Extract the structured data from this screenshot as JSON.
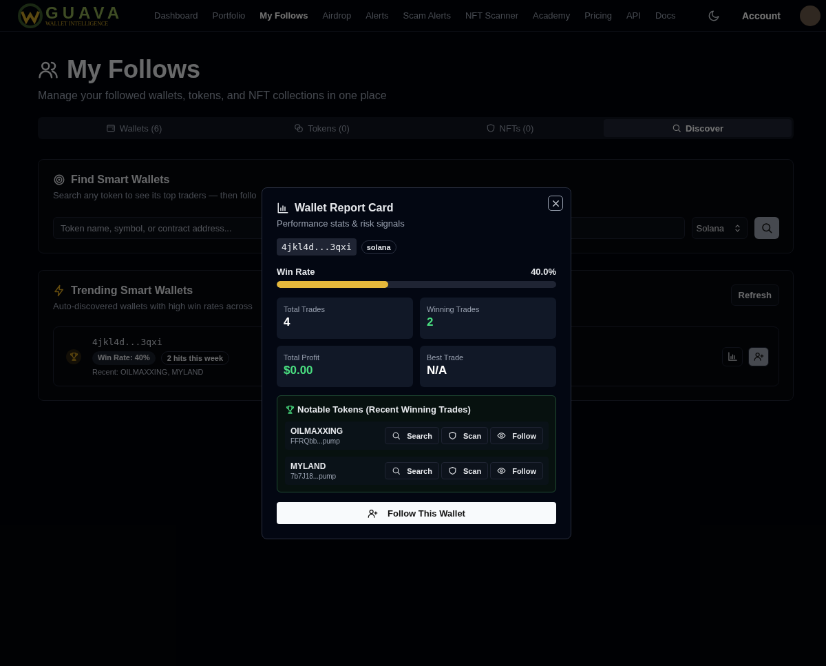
{
  "logo": {
    "name": "GUAVA",
    "tagline": "WALLET INTELLIGENCE"
  },
  "nav": [
    {
      "label": "Dashboard",
      "selected": false
    },
    {
      "label": "Portfolio",
      "selected": false
    },
    {
      "label": "My Follows",
      "selected": true
    },
    {
      "label": "Airdrop",
      "selected": false
    },
    {
      "label": "Alerts",
      "selected": false
    },
    {
      "label": "Scam Alerts",
      "selected": false
    },
    {
      "label": "NFT Scanner",
      "selected": false
    },
    {
      "label": "Academy",
      "selected": false
    },
    {
      "label": "Pricing",
      "selected": false
    },
    {
      "label": "API",
      "selected": false
    },
    {
      "label": "Docs",
      "selected": false
    }
  ],
  "account": "Account",
  "page": {
    "title": "My Follows",
    "subtitle": "Manage your followed wallets, tokens, and NFT collections in one place"
  },
  "tabs": [
    {
      "kind": "wallet",
      "label": "Wallets (6)",
      "selected": false
    },
    {
      "kind": "tokens",
      "label": "Tokens (0)",
      "selected": false
    },
    {
      "kind": "shield",
      "label": "NFTs (0)",
      "selected": false
    },
    {
      "kind": "search",
      "label": "Discover",
      "selected": true
    }
  ],
  "find": {
    "title": "Find Smart Wallets",
    "description": "Search any token to see its top traders — then follo",
    "placeholder": "Token name, symbol, or contract address...",
    "chain": "Solana"
  },
  "trending": {
    "title": "Trending Smart Wallets",
    "description": "Auto-discovered wallets with high win rates across",
    "refresh": "Refresh",
    "wallets": [
      {
        "address": "4jkl4d...3qxi",
        "win_rate": "Win Rate: 40%",
        "hits": "2 hits this week",
        "recent": "Recent: OILMAXXING, MYLAND"
      }
    ]
  },
  "modal": {
    "title": "Wallet Report Card",
    "subtitle": "Performance stats & risk signals",
    "address": "4jkl4d...3qxi",
    "chain": "solana",
    "win_rate_label": "Win Rate",
    "win_rate": "40.0%",
    "level": 0.4,
    "stats": [
      {
        "label": "Total Trades",
        "value": "4",
        "positive": false
      },
      {
        "label": "Winning Trades",
        "value": "2",
        "positive": true
      },
      {
        "label": "Total Profit",
        "value": "$0.00",
        "positive": true
      },
      {
        "label": "Best Trade",
        "value": "N/A",
        "positive": false
      }
    ],
    "notable_title": "Notable Tokens (Recent Winning Trades)",
    "tokens": [
      {
        "symbol": "OILMAXXING",
        "address": "FFRQbb...pump",
        "actions": [
          {
            "kind": "search",
            "label": "Search"
          },
          {
            "kind": "scan",
            "label": "Scan"
          },
          {
            "kind": "follow",
            "label": "Follow"
          }
        ]
      },
      {
        "symbol": "MYLAND",
        "address": "7b7J18...pump",
        "actions": [
          {
            "kind": "search",
            "label": "Search"
          },
          {
            "kind": "scan",
            "label": "Scan"
          },
          {
            "kind": "follow",
            "label": "Follow"
          }
        ]
      }
    ],
    "follow_button": "Follow This Wallet"
  }
}
